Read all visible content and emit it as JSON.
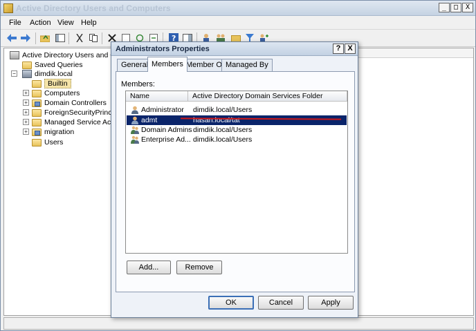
{
  "window": {
    "title": "Active Directory Users and Computers",
    "min": "_",
    "max": "□",
    "close": "X"
  },
  "menu": [
    "File",
    "Action",
    "View",
    "Help"
  ],
  "tree": {
    "root": "Active Directory Users and Cor",
    "saved_queries": "Saved Queries",
    "domain": "dimdik.local",
    "items": [
      "Builtin",
      "Computers",
      "Domain Controllers",
      "ForeignSecurityPrincipa",
      "Managed Service Accou",
      "migration",
      "Users"
    ]
  },
  "dialog": {
    "title": "Administrators Properties",
    "help": "?",
    "close": "X",
    "tabs": [
      "General",
      "Members",
      "Member Of",
      "Managed By"
    ],
    "members_label": "Members:",
    "columns": [
      "Name",
      "Active Directory Domain Services Folder"
    ],
    "rows": [
      {
        "name": "Administrator",
        "folder": "dimdik.local/Users",
        "type": "user"
      },
      {
        "name": "admt",
        "folder": "hasan.local/tat",
        "type": "user"
      },
      {
        "name": "Domain Admins",
        "folder": "dimdik.local/Users",
        "type": "group"
      },
      {
        "name": "Enterprise Ad...",
        "folder": "dimdik.local/Users",
        "type": "group"
      }
    ],
    "buttons": {
      "add": "Add...",
      "remove": "Remove",
      "ok": "OK",
      "cancel": "Cancel",
      "apply": "Apply"
    }
  },
  "colors": {
    "selection": "#0a246a",
    "annotation": "#d01818"
  }
}
